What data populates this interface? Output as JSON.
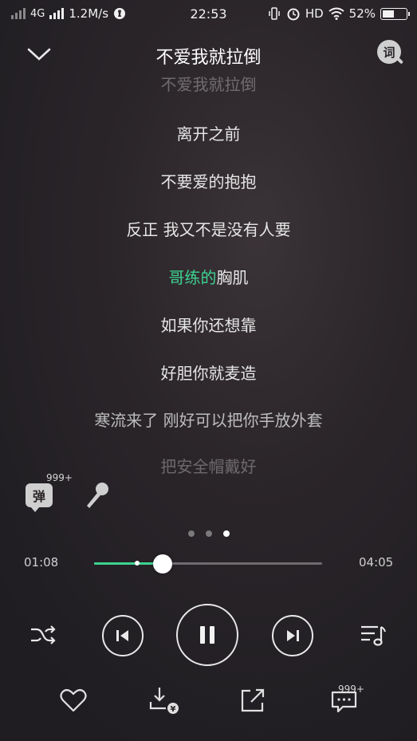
{
  "status_bar": {
    "network": "4G",
    "speed": "1.2M/s",
    "time": "22:53",
    "hd": "HD",
    "battery_percent": "52%",
    "battery_level": 0.52
  },
  "header": {
    "title": "不爱我就拉倒",
    "lyric_button_label": "词"
  },
  "lyrics": {
    "lines": [
      {
        "text": "不爱我就拉倒"
      },
      {
        "text": "离开之前"
      },
      {
        "text": "不要爱的抱抱"
      },
      {
        "text": "反正 我又不是没有人要"
      },
      {
        "highlight": "哥练的",
        "text": "胸肌"
      },
      {
        "text": "如果你还想靠"
      },
      {
        "text": "好胆你就麦造"
      },
      {
        "text": "寒流来了 刚好可以把你手放外套"
      },
      {
        "text": "把安全帽戴好"
      }
    ]
  },
  "actions": {
    "danmu_label": "弹",
    "danmu_count": "999+"
  },
  "pager": {
    "count": 3,
    "active": 2
  },
  "player": {
    "elapsed": "01:08",
    "duration": "04:05",
    "progress": 0.3,
    "buffered": 0.19
  },
  "bottom_bar": {
    "comment_count": "999+"
  },
  "colors": {
    "accent": "#3dd391",
    "text": "#e6e6e6",
    "background": "#26232a"
  },
  "icons": {
    "collapse": "chevron-down-icon",
    "lyric": "lyric-search-icon",
    "danmu": "danmu-icon",
    "mic": "microphone-icon",
    "shuffle": "shuffle-icon",
    "prev": "previous-icon",
    "pause": "pause-icon",
    "next": "next-icon",
    "playlist": "playlist-icon",
    "like": "heart-icon",
    "download": "download-icon",
    "share": "share-icon",
    "comment": "comment-icon"
  }
}
